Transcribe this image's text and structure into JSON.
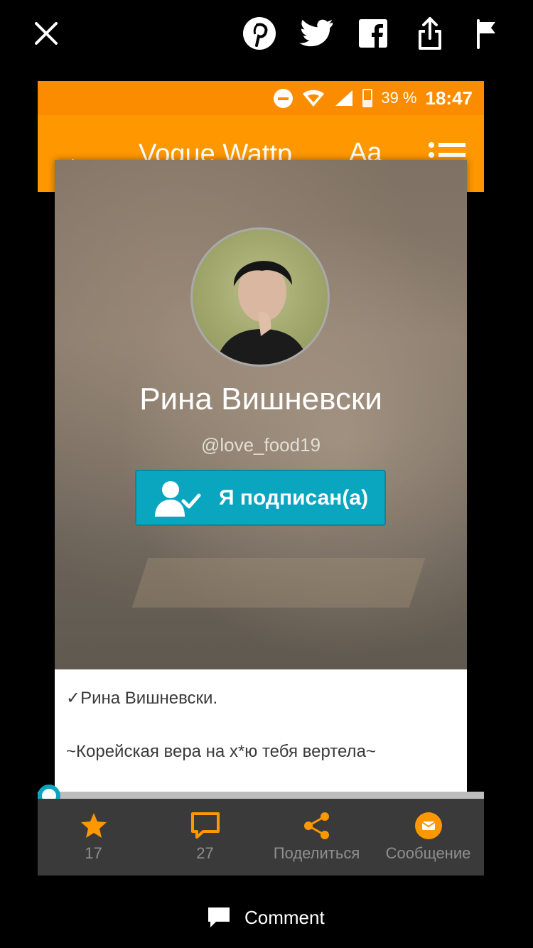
{
  "status_bar": {
    "battery": "39 %",
    "time": "18:47"
  },
  "app_bar": {
    "title": "Vogue Wattp",
    "font_button": "Aa"
  },
  "profile": {
    "name": "Рина Вишневски",
    "handle": "@love_food19",
    "follow_label": "Я подписан(а)",
    "bio_line1": "✓Рина Вишневски.",
    "bio_line2": "~Корейская вера на х*ю тебя вертела~"
  },
  "actions": {
    "votes": "17",
    "comments": "27",
    "share": "Поделиться",
    "message": "Сообщение"
  },
  "footer": {
    "comment_label": "Comment"
  },
  "colors": {
    "orange": "#ff9800",
    "teal": "#0aa6bf",
    "dark": "#3a3a3a"
  }
}
